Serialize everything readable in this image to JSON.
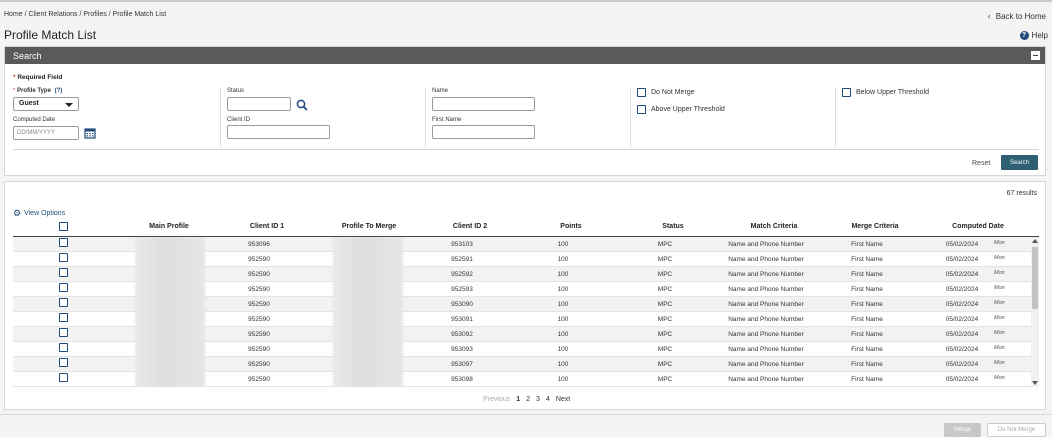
{
  "breadcrumb": "Home / Client Relations / Profiles / Profile Match List",
  "back_label": "Back to Home",
  "page_title": "Profile Match List",
  "help_label": "Help",
  "search": {
    "header": "Search",
    "required_note": "Required Field",
    "profile_type_label": "Profile Type",
    "profile_type_help": "(?)",
    "profile_type_value": "Guest",
    "computed_date_label": "Computed Date",
    "computed_date_placeholder": "DD/MM/YYYY",
    "status_label": "Status",
    "client_id_label": "Client ID",
    "name_label": "Name",
    "first_name_label": "First Name",
    "do_not_merge_label": "Do Not Merge",
    "above_upper_label": "Above Upper Threshold",
    "below_upper_label": "Below Upper Threshold",
    "reset_label": "Reset",
    "search_button": "Search"
  },
  "results": {
    "count": "67 results",
    "view_options": "View Options",
    "columns": [
      "Main Profile",
      "Client ID 1",
      "Profile To Merge",
      "Client ID 2",
      "Points",
      "Status",
      "Match Criteria",
      "Merge Criteria",
      "Computed Date"
    ],
    "rows": [
      {
        "client_id_1": "953096",
        "client_id_2": "953103",
        "points": "100",
        "status": "MPC",
        "match": "Name and Phone Number",
        "merge": "First Name",
        "date": "05/02/2024",
        "day": "Mon"
      },
      {
        "client_id_1": "952590",
        "client_id_2": "952591",
        "points": "100",
        "status": "MPC",
        "match": "Name and Phone Number",
        "merge": "First Name",
        "date": "05/02/2024",
        "day": "Mon"
      },
      {
        "client_id_1": "952590",
        "client_id_2": "952592",
        "points": "100",
        "status": "MPC",
        "match": "Name and Phone Number",
        "merge": "First Name",
        "date": "05/02/2024",
        "day": "Mon"
      },
      {
        "client_id_1": "952590",
        "client_id_2": "952593",
        "points": "100",
        "status": "MPC",
        "match": "Name and Phone Number",
        "merge": "First Name",
        "date": "05/02/2024",
        "day": "Mon"
      },
      {
        "client_id_1": "952590",
        "client_id_2": "953090",
        "points": "100",
        "status": "MPC",
        "match": "Name and Phone Number",
        "merge": "First Name",
        "date": "05/02/2024",
        "day": "Mon"
      },
      {
        "client_id_1": "952590",
        "client_id_2": "953091",
        "points": "100",
        "status": "MPC",
        "match": "Name and Phone Number",
        "merge": "First Name",
        "date": "05/02/2024",
        "day": "Mon"
      },
      {
        "client_id_1": "952590",
        "client_id_2": "953092",
        "points": "100",
        "status": "MPC",
        "match": "Name and Phone Number",
        "merge": "First Name",
        "date": "05/02/2024",
        "day": "Mon"
      },
      {
        "client_id_1": "952590",
        "client_id_2": "953093",
        "points": "100",
        "status": "MPC",
        "match": "Name and Phone Number",
        "merge": "First Name",
        "date": "05/02/2024",
        "day": "Mon"
      },
      {
        "client_id_1": "952590",
        "client_id_2": "953097",
        "points": "100",
        "status": "MPC",
        "match": "Name and Phone Number",
        "merge": "First Name",
        "date": "05/02/2024",
        "day": "Mon"
      },
      {
        "client_id_1": "952590",
        "client_id_2": "953098",
        "points": "100",
        "status": "MPC",
        "match": "Name and Phone Number",
        "merge": "First Name",
        "date": "05/02/2024",
        "day": "Mon"
      }
    ]
  },
  "pager": {
    "previous": "Previous",
    "pages": [
      "1",
      "2",
      "3",
      "4"
    ],
    "next": "Next"
  },
  "footer": {
    "merge": "Merge",
    "do_not_merge": "Do Not Merge"
  }
}
